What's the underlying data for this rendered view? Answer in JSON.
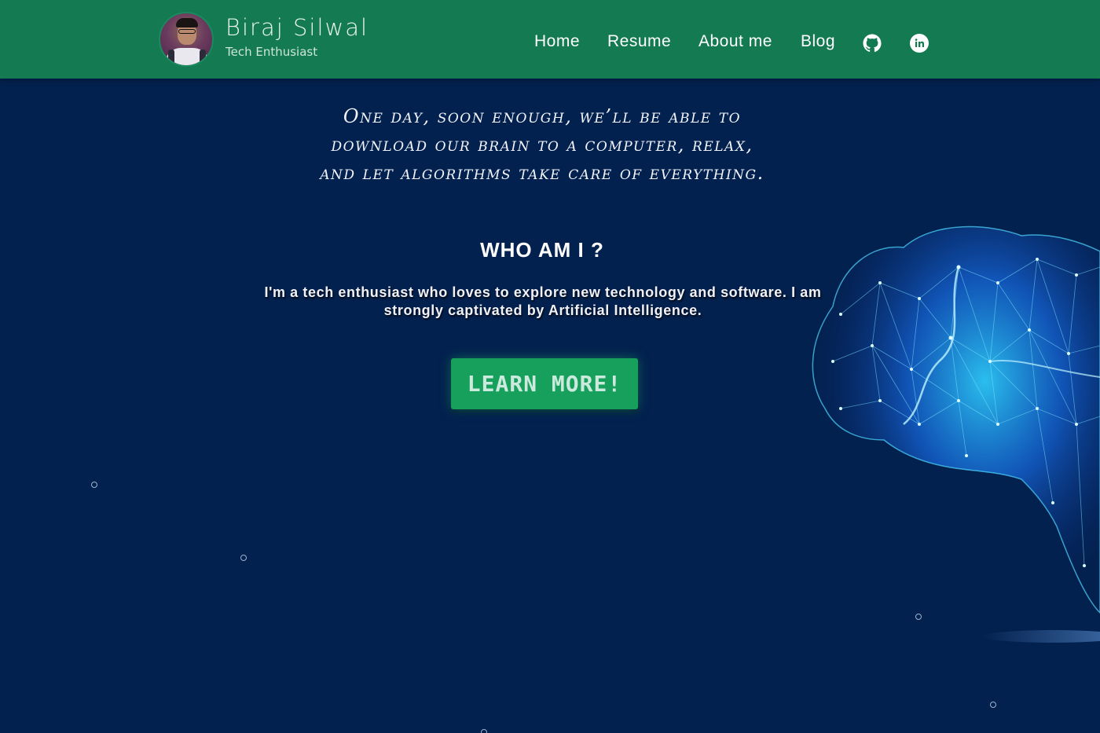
{
  "header": {
    "name": "Biraj Silwal",
    "tagline": "Tech Enthusiast",
    "nav": [
      {
        "label": "Home"
      },
      {
        "label": "Resume"
      },
      {
        "label": "About me"
      },
      {
        "label": "Blog"
      }
    ],
    "icons": [
      "github-icon",
      "linkedin-icon"
    ]
  },
  "hero": {
    "quote_lines": [
      "One day, soon enough, we’ll be able to",
      "download our brain to a computer, relax,",
      "and let algorithms take care of everything."
    ],
    "heading": "WHO AM I ?",
    "bio": "I'm a tech enthusiast who loves to explore new technology and software. I am strongly captivated by Artificial Intelligence.",
    "cta_label": "LEARN MORE!"
  },
  "colors": {
    "header_bg": "#137a52",
    "page_bg": "#03214f",
    "cta_bg": "#16a05c",
    "brain_glow": "#2fd0ff"
  }
}
